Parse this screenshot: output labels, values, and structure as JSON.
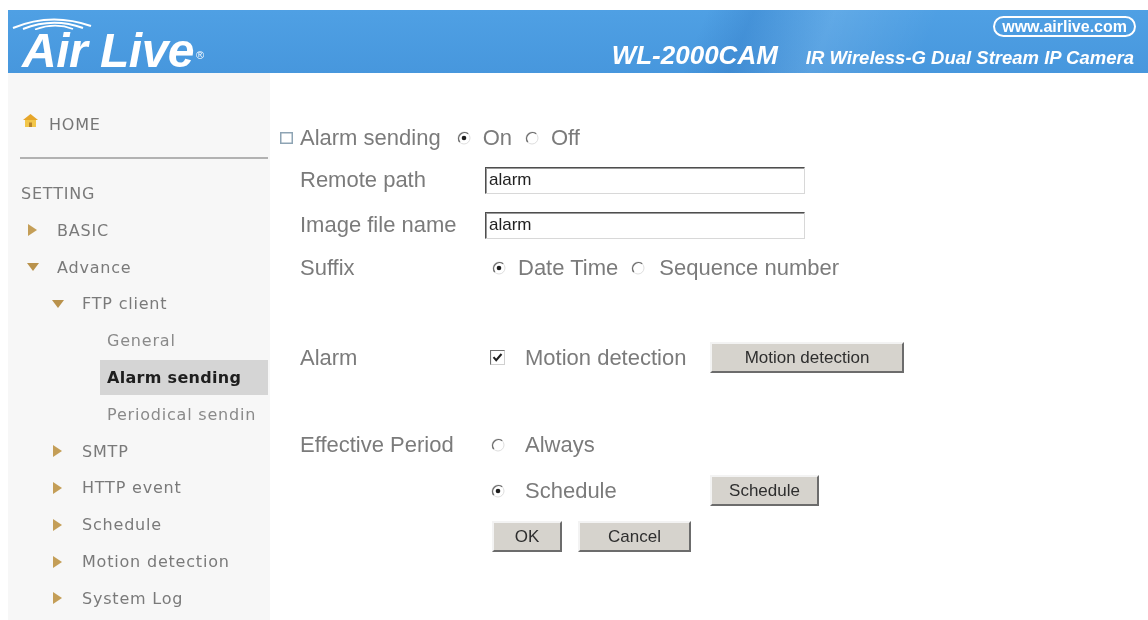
{
  "header": {
    "logo": "Air Live$^{®}$",
    "url": "www.airlive.com",
    "model": "WL-2000CAM",
    "product": "IR Wireless-G Dual Stream IP Camera"
  },
  "sidebar": {
    "home": "HOME",
    "section": "SETTING",
    "items": [
      {
        "kind": "folder",
        "label": "BASIC",
        "expanded": false,
        "selected": false
      },
      {
        "kind": "folder",
        "label": "Advance",
        "expanded": true,
        "selected": false,
        "children": [
          {
            "kind": "folder",
            "label": "FTP client",
            "expanded": true,
            "selected": false,
            "children": [
              {
                "kind": "page",
                "label": "General",
                "selected": false
              },
              {
                "kind": "page",
                "label": "Alarm sending",
                "selected": true
              },
              {
                "kind": "page",
                "label": "Periodical sendin",
                "selected": false
              }
            ]
          },
          {
            "kind": "folder",
            "label": "SMTP",
            "expanded": false,
            "selected": false
          },
          {
            "kind": "folder",
            "label": "HTTP event",
            "expanded": false,
            "selected": false
          },
          {
            "kind": "folder",
            "label": "Schedule",
            "expanded": false,
            "selected": false
          },
          {
            "kind": "folder",
            "label": "Motion detection",
            "expanded": false,
            "selected": false
          },
          {
            "kind": "folder",
            "label": "System Log",
            "expanded": false,
            "selected": false
          }
        ]
      }
    ]
  },
  "form": {
    "alarm_sending": {
      "label": "Alarm sending",
      "options": [
        {
          "label": "On",
          "selected": true
        },
        {
          "label": "Off",
          "selected": false
        }
      ]
    },
    "fields": [
      {
        "label": "Remote path",
        "value": "alarm"
      },
      {
        "label": "Image file name",
        "value": "alarm"
      }
    ],
    "suffix": {
      "label": "Suffix",
      "options": [
        {
          "label": "Date Time",
          "selected": true
        },
        {
          "label": "Sequence number",
          "selected": false
        }
      ]
    },
    "alarm": {
      "label": "Alarm",
      "trigger": {
        "label": "Motion detection",
        "checked": true
      },
      "button": "Motion detection"
    },
    "effective_period": {
      "label": "Effective Period",
      "options": [
        {
          "label": "Always",
          "selected": false
        },
        {
          "label": "Schedule",
          "selected": true,
          "button": "Schedule"
        }
      ]
    },
    "buttons": [
      "OK",
      "Cancel"
    ]
  }
}
